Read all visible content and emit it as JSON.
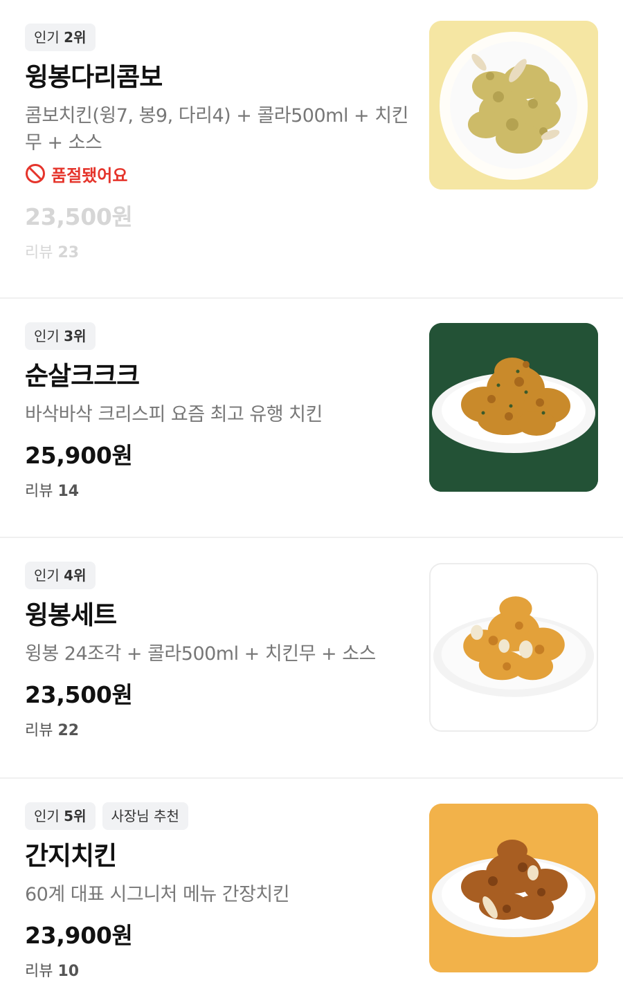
{
  "menu": {
    "items": [
      {
        "badges": [
          {
            "prefix": "인기",
            "value": "2위"
          }
        ],
        "name": "윙봉다리콤보",
        "description": "콤보치킨(윙7, 봉9, 다리4) + 콜라500ml + 치킨무 + 소스",
        "sold_out_label": "품절됐어요",
        "price": "23,500원",
        "review_label": "리뷰",
        "review_count": "23",
        "thumb_bg": "#f5e6a3",
        "sold_out": true
      },
      {
        "badges": [
          {
            "prefix": "인기",
            "value": "3위"
          }
        ],
        "name": "순살크크크",
        "description": "바삭바삭 크리스피 요즘 최고 유행 치킨",
        "price": "25,900원",
        "review_label": "리뷰",
        "review_count": "14",
        "thumb_bg": "#235236",
        "sold_out": false
      },
      {
        "badges": [
          {
            "prefix": "인기",
            "value": "4위"
          }
        ],
        "name": "윙봉세트",
        "description": "윙봉 24조각 + 콜라500ml + 치킨무 + 소스",
        "price": "23,500원",
        "review_label": "리뷰",
        "review_count": "22",
        "thumb_bg": "#ffffff",
        "sold_out": false
      },
      {
        "badges": [
          {
            "prefix": "인기",
            "value": "5위"
          },
          {
            "label": "사장님 추천"
          }
        ],
        "name": "간지치킨",
        "description": "60계 대표 시그니처 메뉴 간장치킨",
        "price": "23,900원",
        "review_label": "리뷰",
        "review_count": "10",
        "thumb_bg": "#f2b24a",
        "sold_out": false
      }
    ]
  },
  "colors": {
    "sold_out": "#e5342b",
    "badge_bg": "#f1f2f4",
    "muted": "#d6d6d6"
  },
  "icons": {
    "sold_out": "prohibited-icon"
  }
}
